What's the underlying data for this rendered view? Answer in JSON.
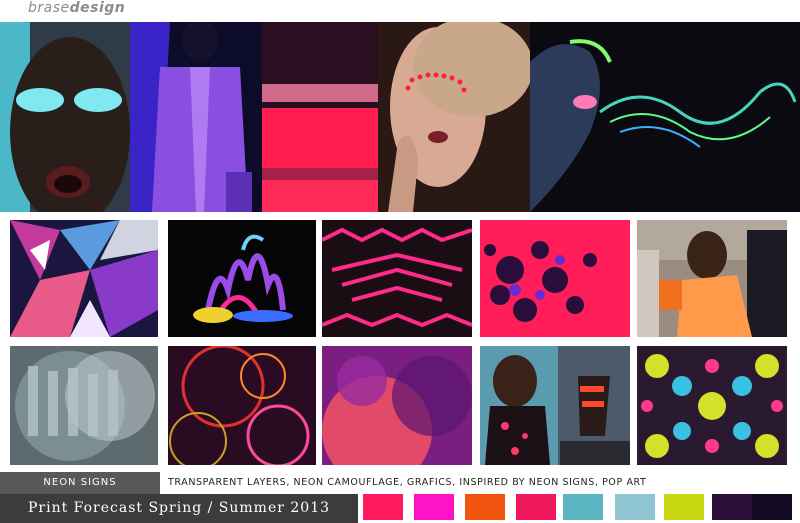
{
  "brand": {
    "part1": "brase",
    "part2": "design"
  },
  "caption": {
    "tag": "neon signs",
    "description": "transparent layers, neon camouflage, grafics, inspired by neon signs, pop art"
  },
  "forecast_title": "Print Forecast Spring / Summer 2013",
  "palette": [
    "#ff1a5e",
    "#ff13c8",
    "#f0540e",
    "#f0185a",
    "#5ab5c1",
    "#8fc4d3",
    "#c8d70f",
    "#2b0d3a",
    "#140a22"
  ],
  "images": {
    "top": [
      "face-cyan-eyeshadow",
      "purple-shirt-figure",
      "pink-color-blocks",
      "neon-dotted-face",
      "neon-lips-smoke"
    ],
    "row1": [
      "shattered-prism",
      "neon-liquid-sculpture",
      "pink-zigzag-stitch",
      "pink-floral-silhouette",
      "orange-jacket-street"
    ],
    "row2": [
      "transparent-silhouettes",
      "neon-circle-rings",
      "purple-pink-circles",
      "neon-camouflage-looks",
      "mirrored-neon-camouflage"
    ]
  }
}
